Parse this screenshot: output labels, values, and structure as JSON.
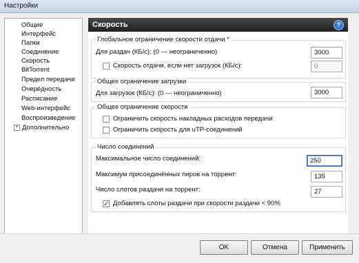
{
  "window": {
    "title": "Настройки"
  },
  "sidebar": {
    "items": [
      {
        "label": "Общие"
      },
      {
        "label": "Интерфейс"
      },
      {
        "label": "Папки"
      },
      {
        "label": "Соединение"
      },
      {
        "label": "Скорость",
        "selected": true
      },
      {
        "label": "BitTorrent"
      },
      {
        "label": "Предел передачи"
      },
      {
        "label": "Очерёдность"
      },
      {
        "label": "Расписание"
      },
      {
        "label": "Web-интерфейс"
      },
      {
        "label": "Воспроизведение"
      },
      {
        "label": "Дополнительно",
        "expandable": true
      }
    ],
    "expander_glyph": "+"
  },
  "header": {
    "title": "Скорость",
    "help_glyph": "?"
  },
  "upload_group": {
    "title": "Глобальное ограничение скорости отдачи *",
    "rate_label": "Для раздач (КБ/с): (0 — неограниченно)",
    "rate_value": "3000",
    "alt_label": "Скорость отдачи, если нет загрузок (КБ/с):",
    "alt_checked": false,
    "alt_value": "0"
  },
  "download_group": {
    "title": "Общее ограничение загрузки",
    "rate_label": "Для загрузок (КБ/с): (0 — неограниченно)",
    "rate_value": "3000"
  },
  "limit_group": {
    "title": "Общее ограничение скорости",
    "overhead_label": "Ограничить скорость накладных расходов передачи",
    "overhead_checked": false,
    "utp_label": "Ограничить скорость для uTP-соединений",
    "utp_checked": false
  },
  "connections_group": {
    "title": "Число соединений",
    "max_conn_label": "Максимальное число соединений:",
    "max_conn_value": "250",
    "max_peers_label": "Максимум присоединённых пиров на торрент:",
    "max_peers_value": "135",
    "slots_label": "Число слотов раздачи на торрент:",
    "slots_value": "27",
    "extra_slots_label": "Добавлять слоты раздачи при скорости раздачи < 90%",
    "extra_slots_checked": true
  },
  "footer": {
    "ok": "OK",
    "cancel": "Отмена",
    "apply": "Применить"
  },
  "check_glyph": "✓",
  "colors": {
    "header_bg": "#2a2a2a",
    "focus_border": "#3060c8",
    "help_icon": "#3a78d8"
  }
}
